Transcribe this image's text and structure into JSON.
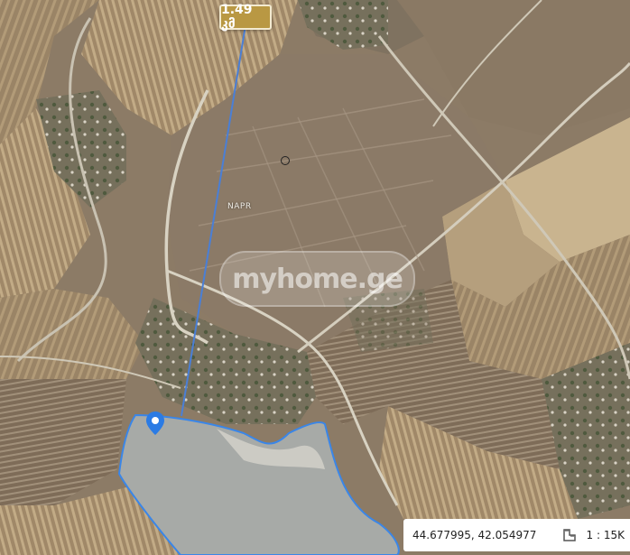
{
  "map": {
    "measurement_label": "1.49 კმ",
    "parcel_label": "NAPR",
    "watermark_text": "myhome.ge",
    "coordinates_text": "44.677995, 42.054977",
    "scale_text": "1 : 15K",
    "colors": {
      "measure_line": "#4a7fd6",
      "lake_boundary": "#3a86e8",
      "badge": "#b99843",
      "marker": "#2b7be4"
    },
    "icons": {
      "location_marker": "location-pin-icon",
      "ruler": "ruler-icon",
      "point": "circle-point-icon"
    }
  }
}
